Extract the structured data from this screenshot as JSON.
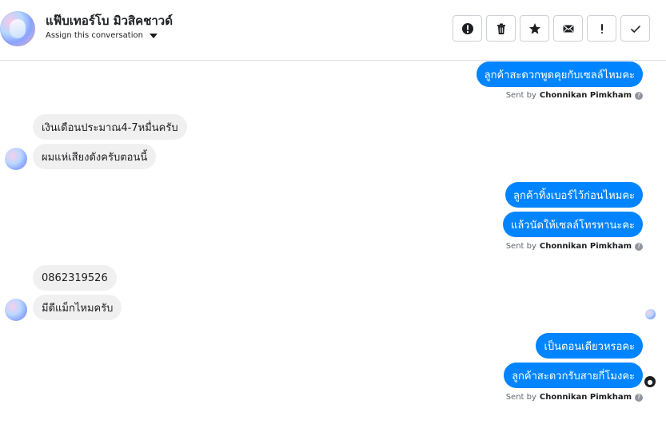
{
  "header": {
    "contact_name": "แฟ๊บเทอร์โบ มิวสิคชาวด์",
    "assign_label": "Assign this conversation"
  },
  "toolbar": [
    {
      "icon": "report-icon",
      "name": "report-button"
    },
    {
      "icon": "trash-icon",
      "name": "delete-button"
    },
    {
      "icon": "star-icon",
      "name": "star-button"
    },
    {
      "icon": "envelope-icon",
      "name": "mark-unread-button"
    },
    {
      "icon": "exclamation-icon",
      "name": "follow-up-button"
    },
    {
      "icon": "check-icon",
      "name": "done-button"
    }
  ],
  "messages": {
    "out1": "ลูกค้าสะดวกพูดคุยกับเซลล์ไหมคะ",
    "in1": "เงินเดือนประมาณ4-7หมื่นครับ",
    "in2": "ผมแห่เสียงดังครับตอนนี้",
    "out2": "ลูกค้าทิ้งเบอร์ไว้ก่อนไหมคะ",
    "out3": "แล้วนัดให้เซลล์โทรหานะคะ",
    "in3": "0862319526",
    "in4": "มีดีแม็กไหมครับ",
    "out4": "เป็นตอนเดียวหรอคะ",
    "out5": "ลูกค้าสะดวกรับสายกี่โมงคะ"
  },
  "sent_by": {
    "prefix": "Sent by",
    "agent": "Chonnikan Pimkham",
    "help": "?"
  },
  "colors": {
    "outgoing": "#0084ff",
    "incoming": "#f1f0f0"
  }
}
